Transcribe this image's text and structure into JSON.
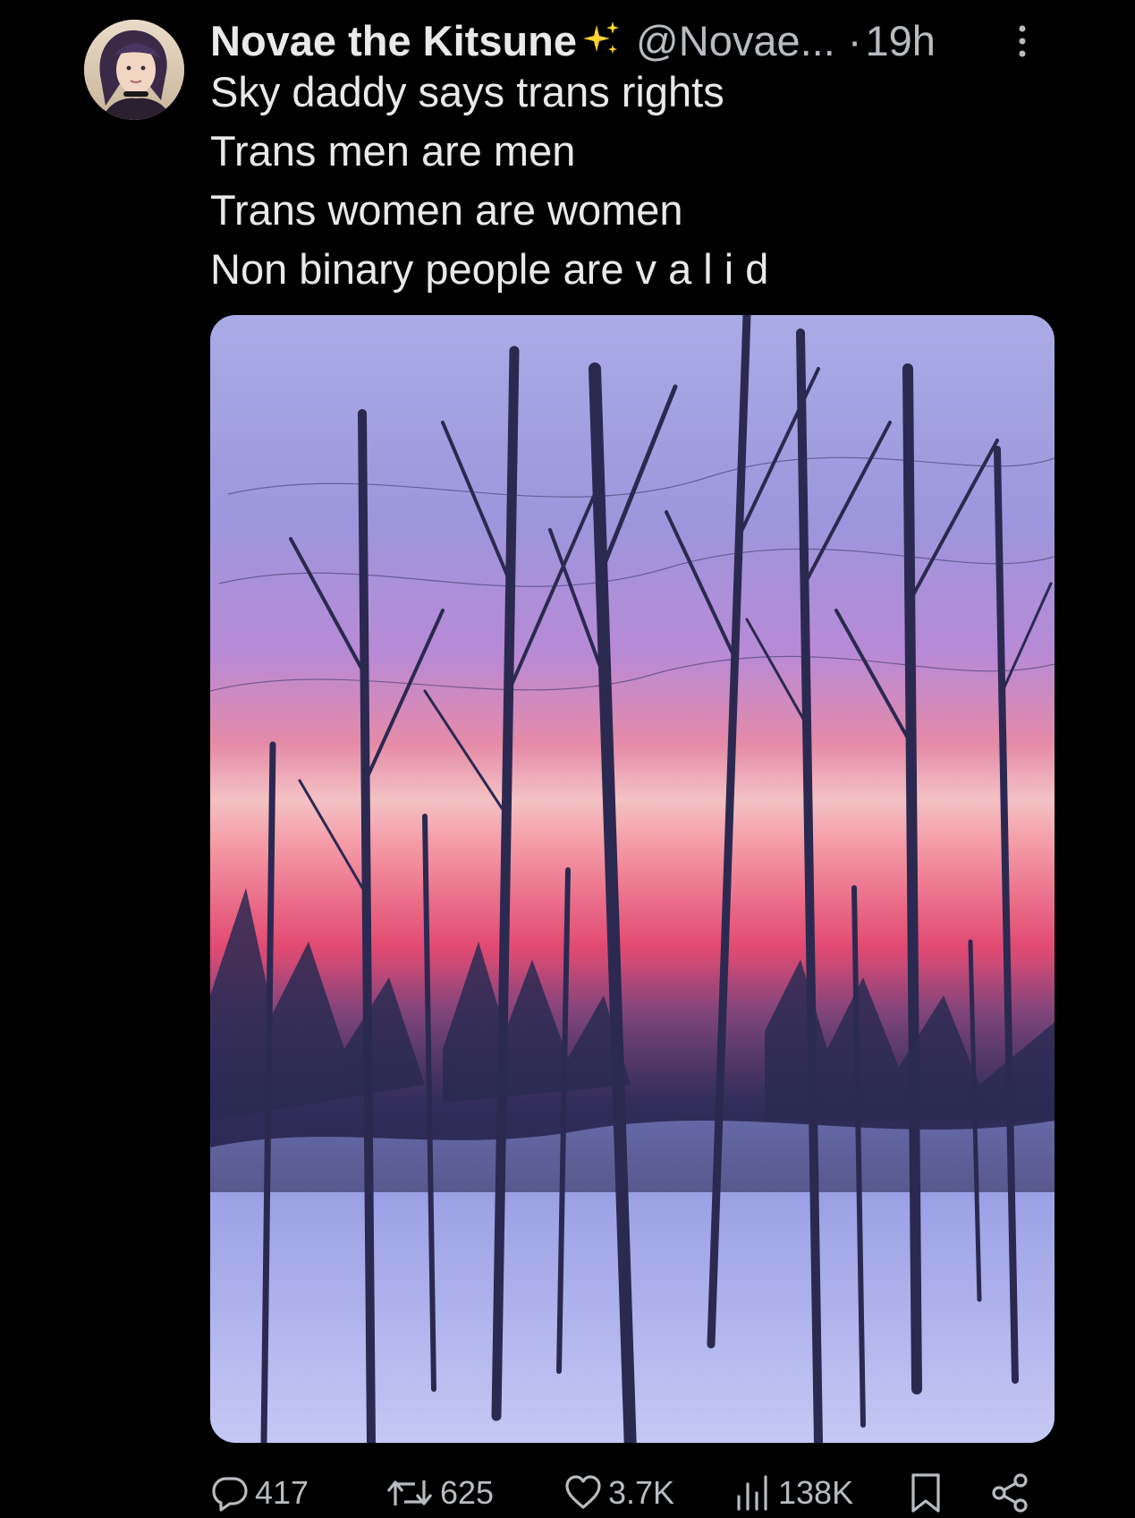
{
  "post": {
    "author": {
      "display_name": "Novae the Kitsune",
      "badge_icon": "sparkles-icon",
      "handle": "@Novae...",
      "separator": "·",
      "time": "19h"
    },
    "text_lines": [
      "Sky daddy says trans rights",
      "Trans men are men",
      "Trans women are women",
      "Non binary people are  v a l i d"
    ],
    "media": {
      "type": "photo",
      "icon": "winter-sunset-forest-image"
    },
    "actions": {
      "replies": "417",
      "reposts": "625",
      "likes": "3.7K",
      "views": "138K",
      "reply_icon": "reply-icon",
      "repost_icon": "repost-icon",
      "like_icon": "heart-icon",
      "views_icon": "views-icon",
      "bookmark_icon": "bookmark-icon",
      "share_icon": "share-icon"
    }
  },
  "colors": {
    "background": "#000000",
    "text": "#e7e9ea",
    "secondary_text": "#b8bcc1",
    "sparkle": "#ffd233"
  }
}
